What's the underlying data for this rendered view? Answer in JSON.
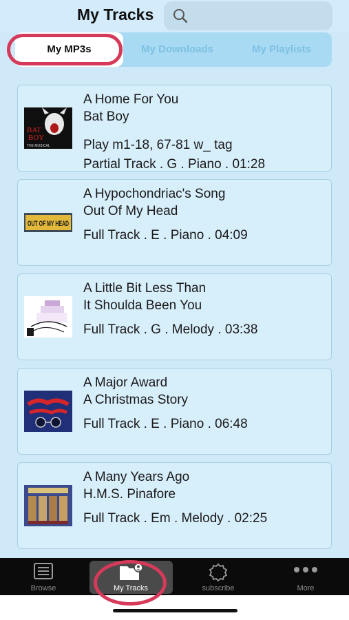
{
  "header": {
    "title": "My Tracks"
  },
  "segments": [
    "My MP3s",
    "My Downloads",
    "My Playlists"
  ],
  "tracks": [
    {
      "title": "A Home For You",
      "show": "Bat Boy",
      "note": "Play m1-18, 67-81 w_ tag",
      "meta": "Partial Track . G . Piano . 01:28"
    },
    {
      "title": "A Hypochondriac's Song",
      "show": "Out Of My Head",
      "note": "",
      "meta": "Full Track . E . Piano . 04:09"
    },
    {
      "title": "A Little Bit Less Than",
      "show": "It Shoulda Been You",
      "note": "",
      "meta": "Full Track . G . Melody . 03:38"
    },
    {
      "title": "A Major Award",
      "show": "A Christmas Story",
      "note": "",
      "meta": "Full Track . E . Piano . 06:48"
    },
    {
      "title": "A Many Years Ago",
      "show": "H.M.S. Pinafore",
      "note": "",
      "meta": "Full Track . Em . Melody . 02:25"
    }
  ],
  "thumbnail_text": {
    "bat_boy": [
      "BAT",
      "BOY",
      "THE MUSICAL"
    ],
    "out_of_my_head": "OUT OF MY HEAD"
  },
  "tabbar": [
    {
      "label": "Browse",
      "icon": "list-icon"
    },
    {
      "label": "My Tracks",
      "icon": "folder-user-icon",
      "active": true
    },
    {
      "label": "subscribe",
      "icon": "badge-icon"
    },
    {
      "label": "More",
      "icon": "more-dots-icon"
    }
  ],
  "colors": {
    "accent": "#7cc0e2",
    "background": "#cfe9f9",
    "callout": "#d63a5a",
    "tabbar": "#0b0b0b"
  }
}
